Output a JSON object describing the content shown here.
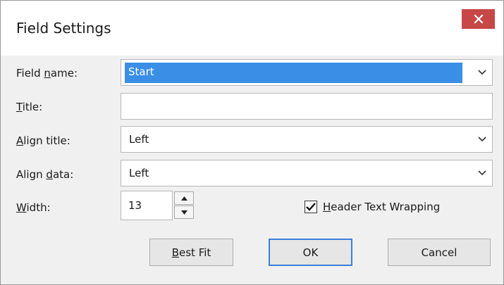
{
  "window": {
    "title": "Field Settings",
    "close_icon": "close-icon"
  },
  "form": {
    "field_name": {
      "label_pre": "Field ",
      "label_key": "n",
      "label_post": "ame:",
      "value": "Start"
    },
    "title": {
      "label_pre": "",
      "label_key": "T",
      "label_post": "itle:",
      "value": ""
    },
    "align_title": {
      "label_pre": "",
      "label_key": "A",
      "label_post": "lign title:",
      "value": "Left"
    },
    "align_data": {
      "label_pre": "Align ",
      "label_key": "d",
      "label_post": "ata:",
      "value": "Left"
    },
    "width": {
      "label_pre": "",
      "label_key": "W",
      "label_post": "idth:",
      "value": "13"
    },
    "header_wrap": {
      "label_pre": "",
      "label_key": "H",
      "label_post": "eader Text Wrapping",
      "checked": true
    }
  },
  "buttons": {
    "best_fit_key": "B",
    "best_fit_rest": "est Fit",
    "ok": "OK",
    "cancel": "Cancel"
  },
  "colors": {
    "selection": "#3a8ee6",
    "close_button": "#c74646",
    "default_button_border": "#3c7fd6"
  }
}
